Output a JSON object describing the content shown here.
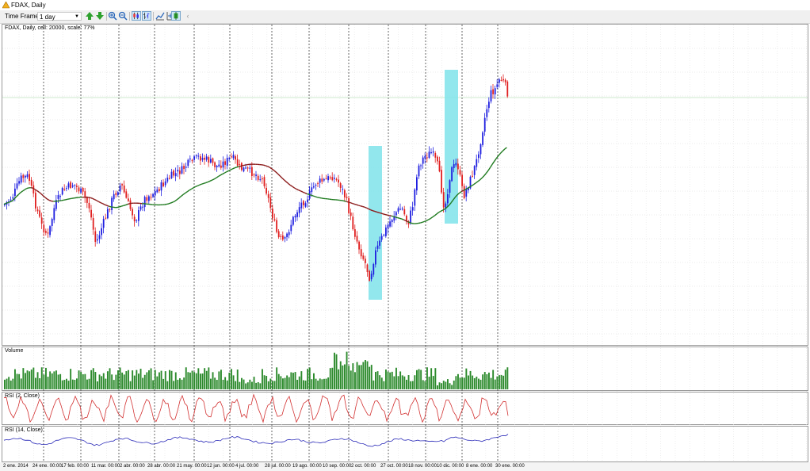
{
  "window": {
    "title": "FDAX, Daily"
  },
  "toolbar": {
    "time_frame_label": "Time Frame:",
    "time_frame_value": "1 day",
    "buttons": [
      {
        "name": "arrow-up-green-icon",
        "active": false
      },
      {
        "name": "arrow-down-green-icon",
        "active": false
      },
      {
        "name": "zoom-in-icon",
        "active": false
      },
      {
        "name": "zoom-out-icon",
        "active": false
      },
      {
        "name": "candlestick-chart-icon",
        "active": true
      },
      {
        "name": "bar-chart-icon",
        "active": true
      },
      {
        "name": "line-chart-icon",
        "active": false
      },
      {
        "name": "crosshair-icon",
        "active": false
      },
      {
        "name": "indicator-icon",
        "active": true
      },
      {
        "name": "chevron-left-icon",
        "active": false
      }
    ]
  },
  "price_pane": {
    "label": "FDAX, Daily, cell: 20000, scale: 77%"
  },
  "volume_pane": {
    "label": "Volume"
  },
  "rsi2_pane": {
    "label": "RSI (2, Close)"
  },
  "rsi14_pane": {
    "label": "RSI (14, Close)"
  },
  "x_axis": {
    "labels": [
      "2 ene. 2014",
      "24 ene. 00:00",
      "17 feb. 00:00",
      "11 mar. 00:00",
      "2 abr. 00:00",
      "28 abr. 00:00",
      "21 may. 00:00",
      "12 jun. 00:00",
      "4 jul. 00:00",
      "28 jul. 00:00",
      "19 ago. 00:00",
      "10 sep. 00:00",
      "2 oct. 00:00",
      "27 oct. 00:00",
      "18 nov. 00:00",
      "10 dic. 00:00",
      "8 ene. 00:00",
      "30 ene. 00:00"
    ]
  },
  "colors": {
    "bull_candle": "#1f1fe0",
    "bear_candle": "#e02020",
    "sma_above": "#1e7a1e",
    "sma_below": "#8b1a1a",
    "highlight": "#7fe3ea",
    "volume_bar": "#2c8a2c",
    "rsi2_line": "#d23030",
    "rsi14_line": "#2a2ab8"
  }
}
